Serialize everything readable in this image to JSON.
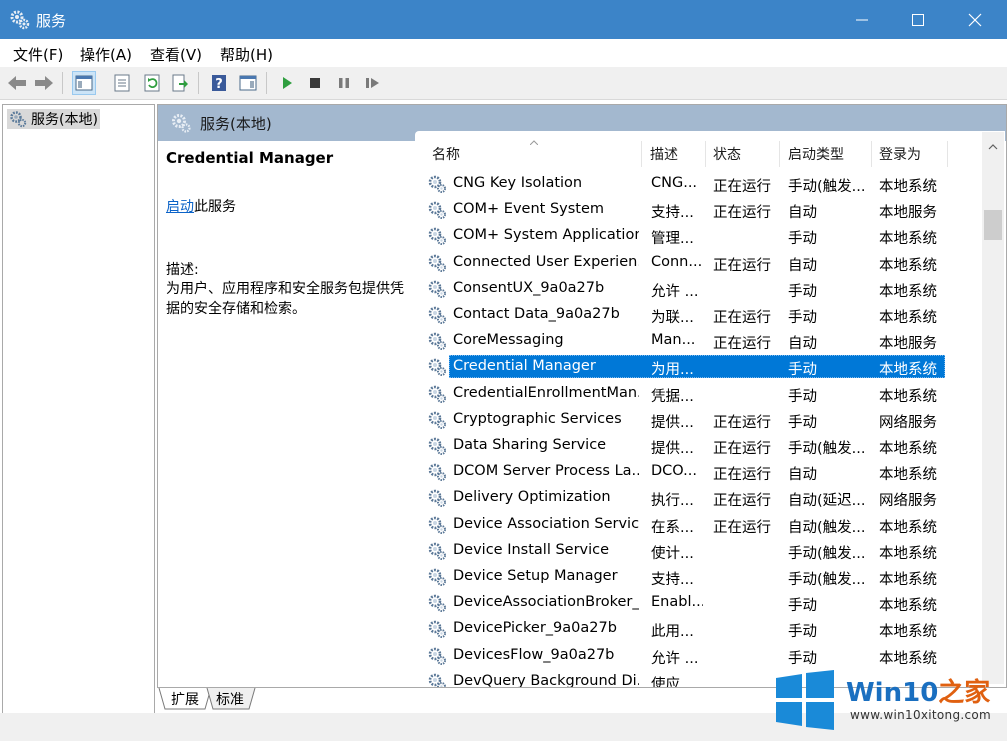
{
  "window": {
    "title": "服务"
  },
  "menu": [
    "文件(F)",
    "操作(A)",
    "查看(V)",
    "帮助(H)"
  ],
  "tree": {
    "root_label": "服务(本地)"
  },
  "pane": {
    "header": "服务(本地)",
    "selected_service": "Credential Manager",
    "start_link": "启动",
    "start_suffix": "此服务",
    "desc_label": "描述:",
    "desc_text": "为用户、应用程序和安全服务包提供凭据的安全存储和检索。"
  },
  "columns": {
    "name": "名称",
    "description": "描述",
    "status": "状态",
    "startup": "启动类型",
    "logon": "登录为"
  },
  "services": [
    {
      "name": "CNG Key Isolation",
      "desc": "CNG...",
      "status": "正在运行",
      "startup": "手动(触发...",
      "logon": "本地系统"
    },
    {
      "name": "COM+ Event System",
      "desc": "支持...",
      "status": "正在运行",
      "startup": "自动",
      "logon": "本地服务"
    },
    {
      "name": "COM+ System Application",
      "desc": "管理...",
      "status": "",
      "startup": "手动",
      "logon": "本地系统"
    },
    {
      "name": "Connected User Experien...",
      "desc": "Conn...",
      "status": "正在运行",
      "startup": "自动",
      "logon": "本地系统"
    },
    {
      "name": "ConsentUX_9a0a27b",
      "desc": "允许 ...",
      "status": "",
      "startup": "手动",
      "logon": "本地系统"
    },
    {
      "name": "Contact Data_9a0a27b",
      "desc": "为联...",
      "status": "正在运行",
      "startup": "手动",
      "logon": "本地系统"
    },
    {
      "name": "CoreMessaging",
      "desc": "Man...",
      "status": "正在运行",
      "startup": "自动",
      "logon": "本地服务"
    },
    {
      "name": "Credential Manager",
      "desc": "为用...",
      "status": "",
      "startup": "手动",
      "logon": "本地系统"
    },
    {
      "name": "CredentialEnrollmentMan...",
      "desc": "凭据...",
      "status": "",
      "startup": "手动",
      "logon": "本地系统"
    },
    {
      "name": "Cryptographic Services",
      "desc": "提供...",
      "status": "正在运行",
      "startup": "手动",
      "logon": "网络服务"
    },
    {
      "name": "Data Sharing Service",
      "desc": "提供...",
      "status": "正在运行",
      "startup": "手动(触发...",
      "logon": "本地系统"
    },
    {
      "name": "DCOM Server Process La...",
      "desc": "DCO...",
      "status": "正在运行",
      "startup": "自动",
      "logon": "本地系统"
    },
    {
      "name": "Delivery Optimization",
      "desc": "执行...",
      "status": "正在运行",
      "startup": "自动(延迟...",
      "logon": "网络服务"
    },
    {
      "name": "Device Association Service",
      "desc": "在系...",
      "status": "正在运行",
      "startup": "自动(触发...",
      "logon": "本地系统"
    },
    {
      "name": "Device Install Service",
      "desc": "使计...",
      "status": "",
      "startup": "手动(触发...",
      "logon": "本地系统"
    },
    {
      "name": "Device Setup Manager",
      "desc": "支持...",
      "status": "",
      "startup": "手动(触发...",
      "logon": "本地系统"
    },
    {
      "name": "DeviceAssociationBroker_...",
      "desc": "Enabl...",
      "status": "",
      "startup": "手动",
      "logon": "本地系统"
    },
    {
      "name": "DevicePicker_9a0a27b",
      "desc": "此用...",
      "status": "",
      "startup": "手动",
      "logon": "本地系统"
    },
    {
      "name": "DevicesFlow_9a0a27b",
      "desc": "允许 ...",
      "status": "",
      "startup": "手动",
      "logon": "本地系统"
    },
    {
      "name": "DevQuery Background Di...",
      "desc": "使应...",
      "status": "",
      "startup": "",
      "logon": ""
    }
  ],
  "selected_index": 7,
  "tabs": [
    "扩展",
    "标准"
  ],
  "watermark": {
    "brand": "Win10",
    "suffix": "之家",
    "url": "www.win10xitong.com"
  },
  "colors": {
    "titlebar": "#3c84c8",
    "selection": "#0078d7",
    "header": "#a3b8cf",
    "link": "#0b63c8"
  }
}
